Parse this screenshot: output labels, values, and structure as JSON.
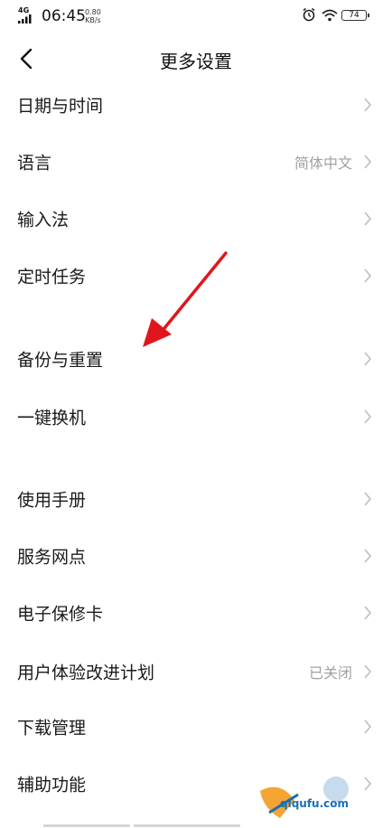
{
  "status_bar": {
    "network": "4G",
    "time": "06:45",
    "speed_value": "0.80",
    "speed_unit": "KB/s",
    "battery": "74"
  },
  "header": {
    "title": "更多设置"
  },
  "rows": [
    {
      "label": "日期与时间",
      "value": ""
    },
    {
      "label": "语言",
      "value": "简体中文"
    },
    {
      "label": "输入法",
      "value": ""
    },
    {
      "label": "定时任务",
      "value": ""
    },
    {
      "label": "备份与重置",
      "value": ""
    },
    {
      "label": "一键换机",
      "value": ""
    },
    {
      "label": "使用手册",
      "value": ""
    },
    {
      "label": "服务网点",
      "value": ""
    },
    {
      "label": "电子保修卡",
      "value": ""
    },
    {
      "label": "用户体验改进计划",
      "value": "已关闭"
    },
    {
      "label": "下载管理",
      "value": ""
    },
    {
      "label": "辅助功能",
      "value": ""
    }
  ],
  "watermark": {
    "text": "qiqufu.com"
  },
  "colors": {
    "annotation_arrow": "#e0161c",
    "chevron": "#bdbdbd",
    "secondary_text": "#a0a0a0"
  }
}
